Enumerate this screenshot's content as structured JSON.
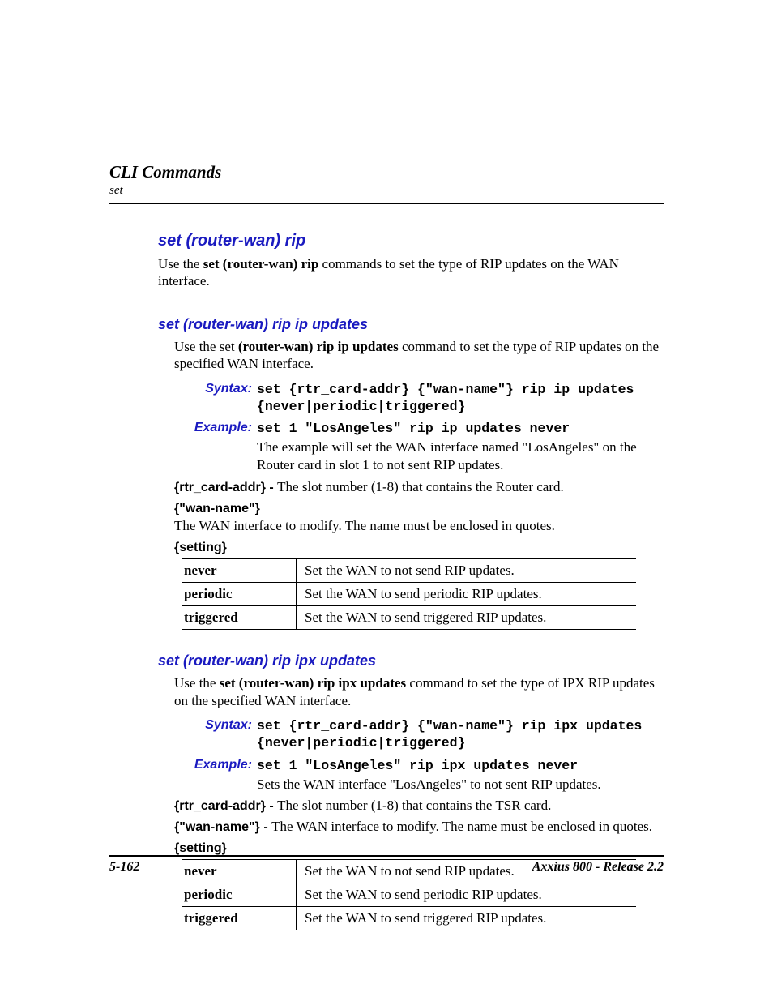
{
  "header": {
    "chapter": "CLI Commands",
    "sub": "set"
  },
  "main": {
    "title": "set (router-wan) rip",
    "intro_a": "Use the ",
    "intro_bold": "set (router-wan) rip",
    "intro_b": " commands to set the type of RIP updates on the WAN interface."
  },
  "sec1": {
    "title": "set (router-wan) rip ip updates",
    "intro_a": "Use the set ",
    "intro_bold": "(router-wan) rip ip updates",
    "intro_b": " command to set the type of RIP updates on the specified WAN interface.",
    "syntax_label": "Syntax:",
    "syntax_code": "set {rtr_card-addr} {\"wan-name\"} rip ip updates {never|periodic|triggered}",
    "example_label": "Example:",
    "example_code": "set 1 \"LosAngeles\" rip ip updates never",
    "example_note": "The example will set the WAN interface named \"LosAngeles\" on the Router card in slot 1 to not sent RIP updates.",
    "p1_key": "{rtr_card-addr} - ",
    "p1_desc": "The slot number (1-8) that contains the Router card.",
    "p2_key": "{\"wan-name\"}",
    "p2_desc": "The WAN interface to modify. The name must be enclosed in quotes.",
    "p3_key": "{setting}",
    "table": [
      {
        "k": "never",
        "v": "Set the WAN to not send RIP updates."
      },
      {
        "k": "periodic",
        "v": "Set the WAN to send periodic RIP updates."
      },
      {
        "k": "triggered",
        "v": "Set the WAN to send triggered RIP updates."
      }
    ]
  },
  "sec2": {
    "title": "set (router-wan) rip ipx updates",
    "intro_a": "Use the ",
    "intro_bold": "set (router-wan) rip ipx updates",
    "intro_b": " command to set the type of IPX RIP updates on the specified WAN interface.",
    "syntax_label": "Syntax:",
    "syntax_code": "set {rtr_card-addr} {\"wan-name\"} rip ipx updates {never|periodic|triggered}",
    "example_label": "Example:",
    "example_code": "set 1 \"LosAngeles\" rip ipx updates never",
    "example_note": "Sets the WAN interface \"LosAngeles\" to not sent RIP updates.",
    "p1_key": "{rtr_card-addr} - ",
    "p1_desc": "The slot number (1-8) that contains the TSR card.",
    "p2_key": "{\"wan-name\"} - ",
    "p2_desc": "The WAN interface to modify. The name must be enclosed in quotes.",
    "p3_key": "{setting}",
    "table": [
      {
        "k": "never",
        "v": "Set the WAN to not send RIP updates."
      },
      {
        "k": "periodic",
        "v": "Set the WAN to send periodic RIP updates."
      },
      {
        "k": "triggered",
        "v": "Set the WAN to send triggered RIP updates."
      }
    ]
  },
  "footer": {
    "left": "5-162",
    "right": "Axxius 800 - Release 2.2"
  }
}
